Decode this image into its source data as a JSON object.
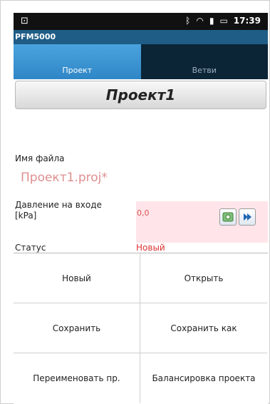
{
  "status_bar": {
    "time": "17:39"
  },
  "app": {
    "title": "PFM5000"
  },
  "tabs": [
    {
      "label": "Проект"
    },
    {
      "label": "Ветви"
    }
  ],
  "project": {
    "name": "Проект1"
  },
  "form": {
    "filename_label": "Имя файла",
    "filename_value": "Проект1.proj*",
    "pressure_label_line1": "Давление на входе",
    "pressure_label_line2": "[kPa]",
    "pressure_value": "0,0",
    "status_label": "Статус",
    "status_value": "Новый"
  },
  "menu": [
    {
      "label": "Новый"
    },
    {
      "label": "Открыть"
    },
    {
      "label": "Сохранить"
    },
    {
      "label": "Сохранить как"
    },
    {
      "label": "Переименовать пр."
    },
    {
      "label": "Балансировка проекта"
    }
  ],
  "colors": {
    "app_bar": "#1f5d86",
    "active_tab": "#2f86c6",
    "inactive_tab": "#0b2436",
    "pressure_value": "#d55"
  }
}
